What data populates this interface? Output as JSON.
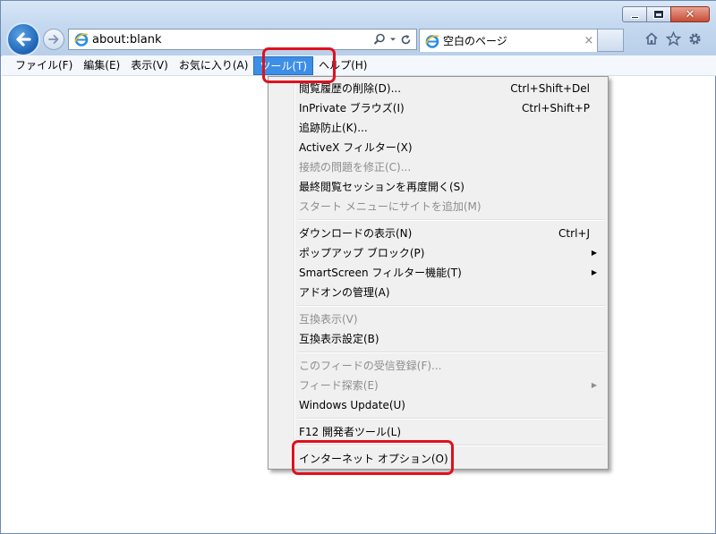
{
  "window": {
    "address_url": "about:blank",
    "tab_title": "空白のページ",
    "tab_close": "×"
  },
  "menubar": [
    {
      "label": "ファイル(F)"
    },
    {
      "label": "編集(E)"
    },
    {
      "label": "表示(V)"
    },
    {
      "label": "お気に入り(A)"
    },
    {
      "label": "ツール(T)",
      "active": true
    },
    {
      "label": "ヘルプ(H)"
    }
  ],
  "tools_menu": [
    {
      "label": "閲覧履歴の削除(D)...",
      "shortcut": "Ctrl+Shift+Del"
    },
    {
      "label": "InPrivate ブラウズ(I)",
      "shortcut": "Ctrl+Shift+P"
    },
    {
      "label": "追跡防止(K)..."
    },
    {
      "label": "ActiveX フィルター(X)"
    },
    {
      "label": "接続の問題を修正(C)...",
      "disabled": true
    },
    {
      "label": "最終閲覧セッションを再度開く(S)"
    },
    {
      "label": "スタート メニューにサイトを追加(M)",
      "disabled": true
    },
    {
      "separator": true
    },
    {
      "label": "ダウンロードの表示(N)",
      "shortcut": "Ctrl+J"
    },
    {
      "label": "ポップアップ ブロック(P)",
      "submenu": true
    },
    {
      "label": "SmartScreen フィルター機能(T)",
      "submenu": true
    },
    {
      "label": "アドオンの管理(A)"
    },
    {
      "separator": true
    },
    {
      "label": "互換表示(V)",
      "disabled": true
    },
    {
      "label": "互換表示設定(B)"
    },
    {
      "separator": true
    },
    {
      "label": "このフィードの受信登録(F)...",
      "disabled": true
    },
    {
      "label": "フィード探索(E)",
      "disabled": true,
      "submenu": true
    },
    {
      "label": "Windows Update(U)"
    },
    {
      "separator": true
    },
    {
      "label": "F12 開発者ツール(L)"
    },
    {
      "separator": true
    },
    {
      "label": "インターネット オプション(O)"
    }
  ],
  "colors": {
    "highlight_red": "#e0101e",
    "menu_active": "#3d8ee6"
  },
  "icons": {
    "back": "back-arrow-icon",
    "forward": "forward-arrow-icon",
    "home": "home-icon",
    "favorites": "star-icon",
    "tools": "gear-icon"
  }
}
